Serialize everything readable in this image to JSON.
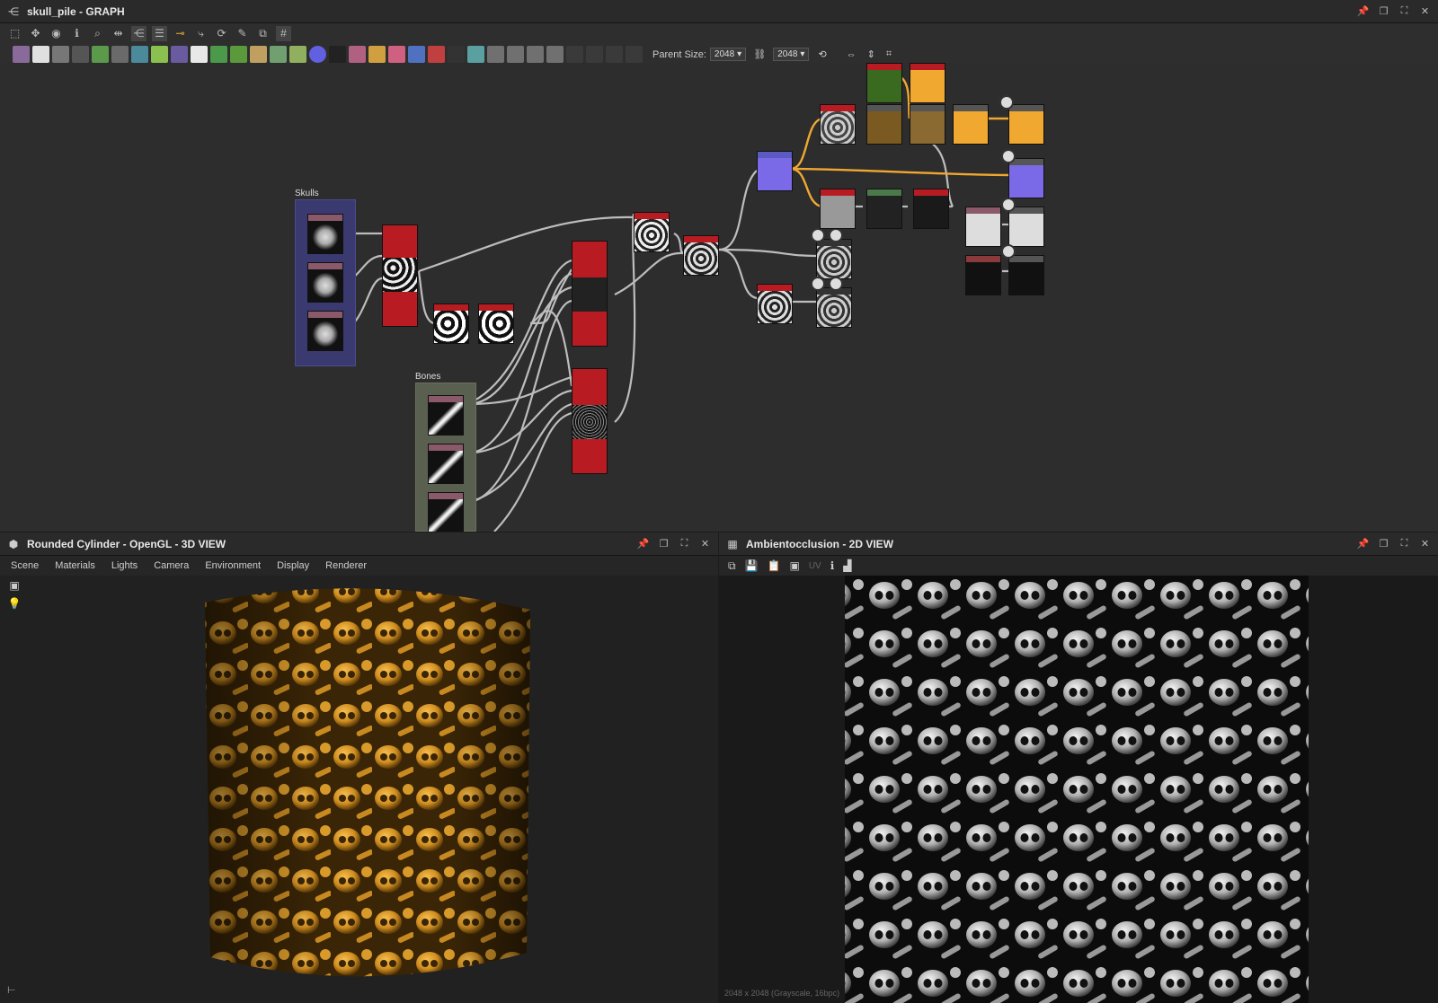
{
  "graph": {
    "title": "skull_pile - GRAPH",
    "parent_size_label": "Parent Size:",
    "parent_size_value": "2048",
    "size_value_2": "2048",
    "frames": [
      {
        "label": "Skulls"
      },
      {
        "label": "Bones"
      }
    ]
  },
  "view3d": {
    "title": "Rounded Cylinder - OpenGL - 3D VIEW",
    "menu": [
      "Scene",
      "Materials",
      "Lights",
      "Camera",
      "Environment",
      "Display",
      "Renderer"
    ]
  },
  "view2d": {
    "title": "Ambientocclusion - 2D VIEW",
    "uv_label": "UV",
    "status": "2048 x 2048 (Grayscale, 16bpc)"
  },
  "colors": {
    "accent_orange": "#f0a830",
    "node_red": "#b81c22",
    "frame_blue": "#3a3a70",
    "frame_green": "#5a6050",
    "skull_gold": "#d99a2a"
  },
  "icons": {
    "graph": "graph-icon",
    "pin": "pin-icon",
    "restore": "restore-icon",
    "maximize": "maximize-icon",
    "close": "close-icon"
  }
}
